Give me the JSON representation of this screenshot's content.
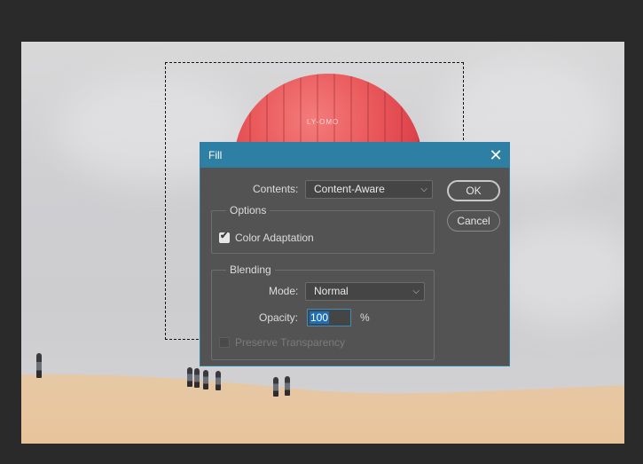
{
  "dialog": {
    "title": "Fill",
    "close_icon": "close-icon",
    "contents_label": "Contents:",
    "contents_value": "Content-Aware",
    "options_title": "Options",
    "color_adaptation_label": "Color Adaptation",
    "color_adaptation_checked": true,
    "blending_title": "Blending",
    "mode_label": "Mode:",
    "mode_value": "Normal",
    "opacity_label": "Opacity:",
    "opacity_value": "100",
    "opacity_unit": "%",
    "preserve_label": "Preserve Transparency",
    "preserve_checked": false,
    "ok_label": "OK",
    "cancel_label": "Cancel"
  },
  "photo": {
    "balloon_text": "LY-OMO"
  },
  "colors": {
    "titlebar": "#2d80a3",
    "dialog_bg": "#535353",
    "app_bg": "#2a2a2a"
  }
}
